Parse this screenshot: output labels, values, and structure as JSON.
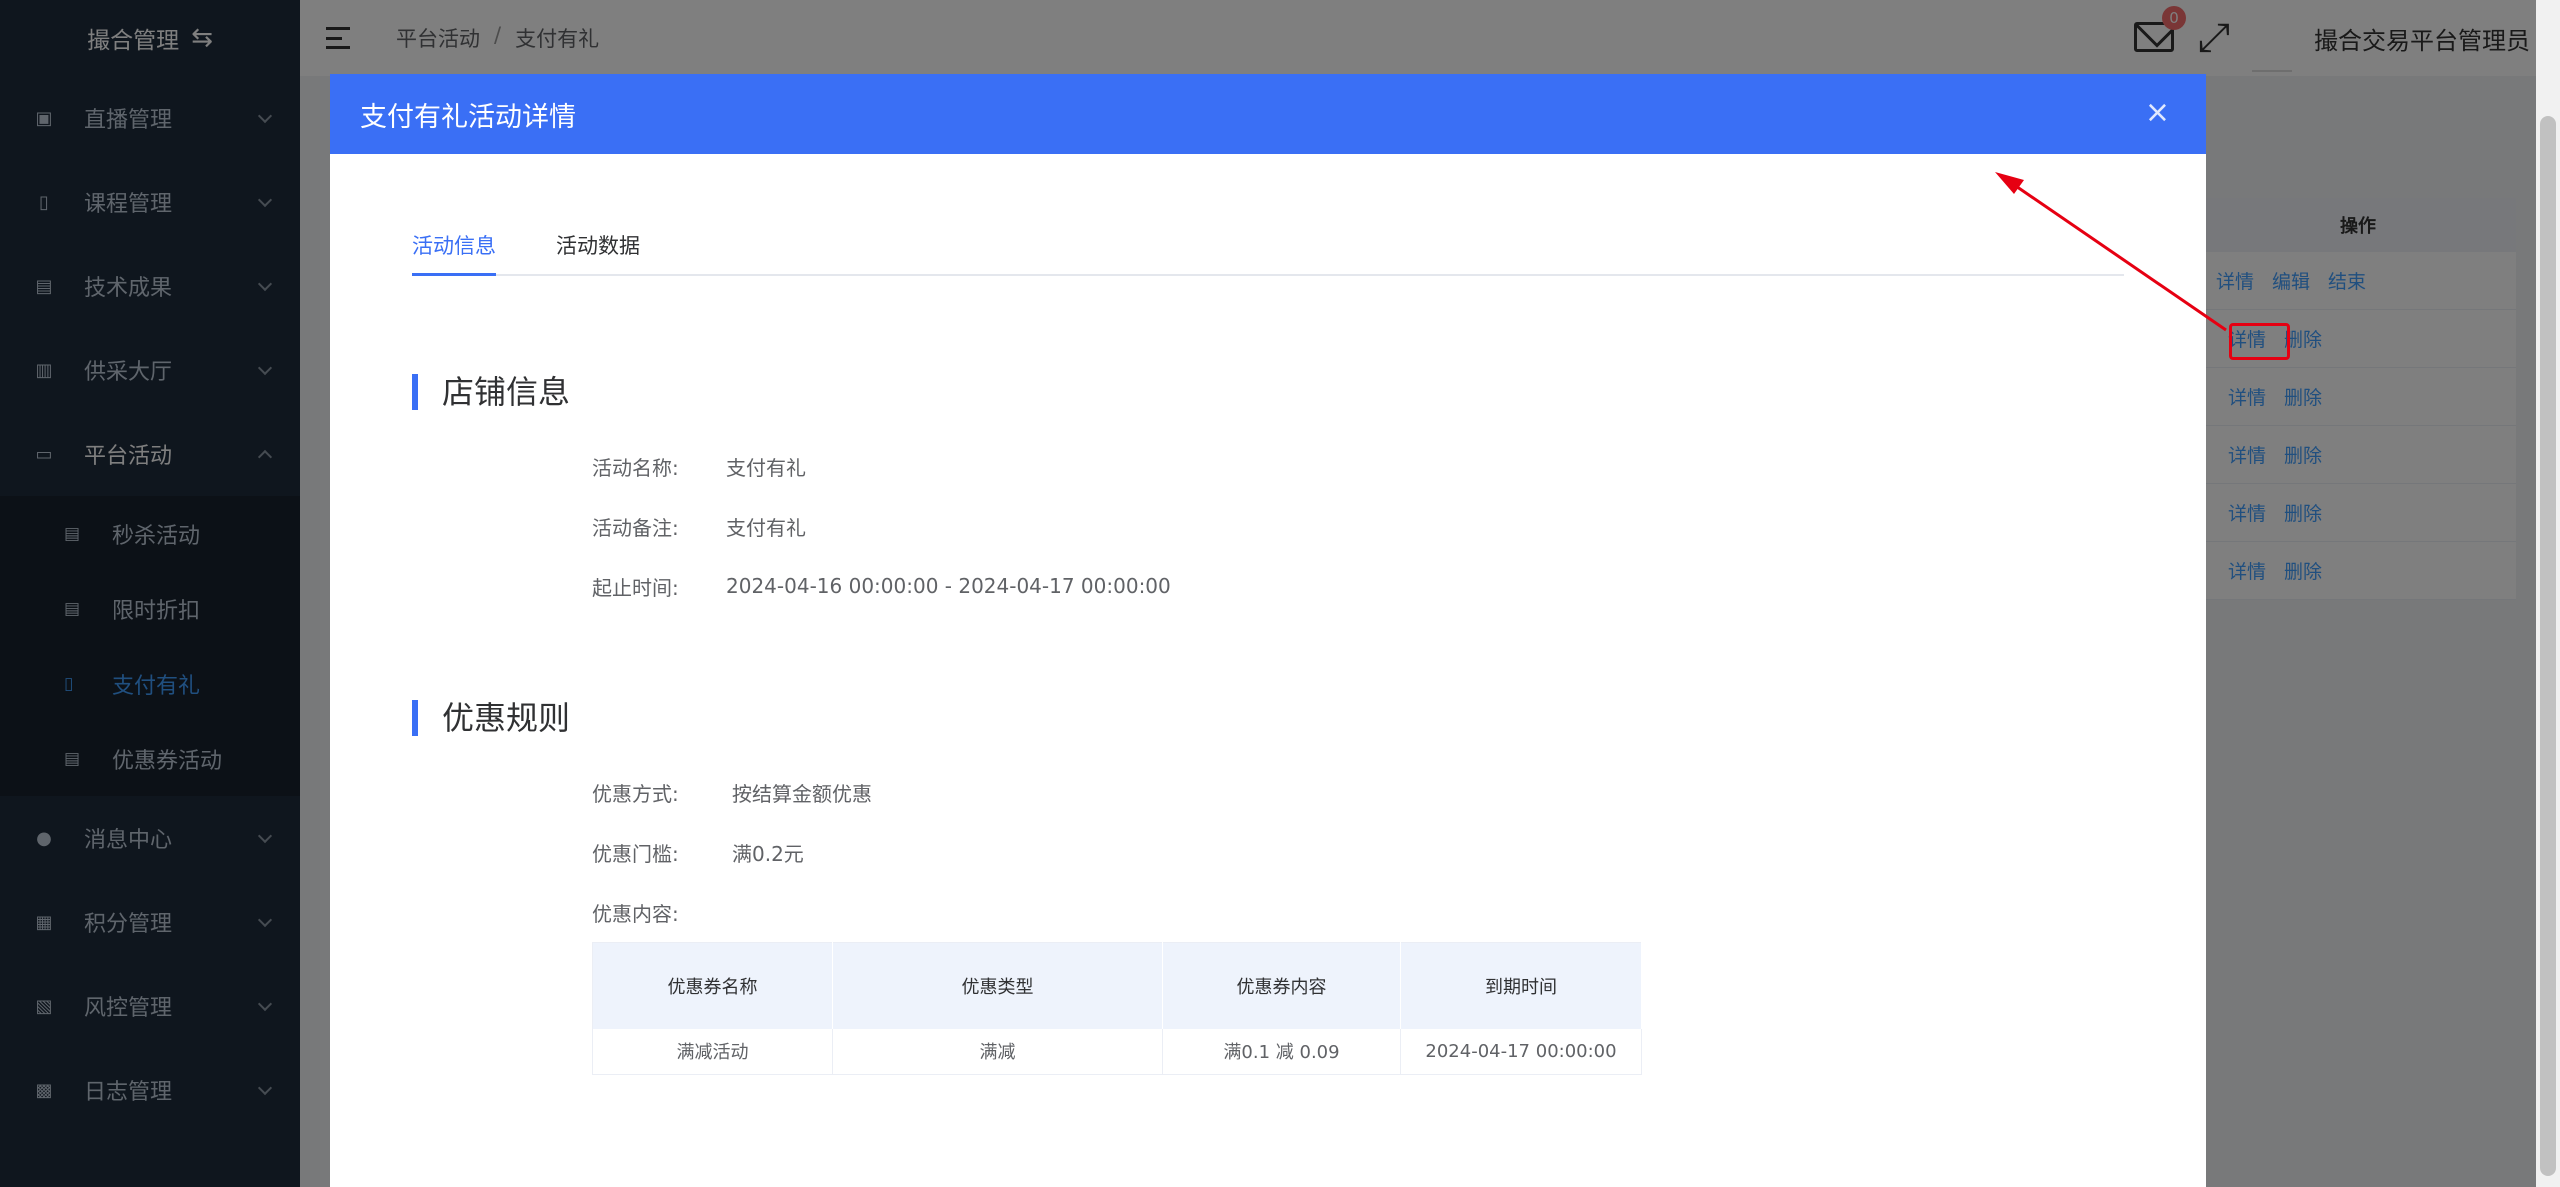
{
  "sidebar": {
    "brand": "撮合管理",
    "items": [
      {
        "label": "直播管理"
      },
      {
        "label": "课程管理"
      },
      {
        "label": "技术成果"
      },
      {
        "label": "供采大厅"
      },
      {
        "label": "平台活动"
      },
      {
        "label": "消息中心"
      },
      {
        "label": "积分管理"
      },
      {
        "label": "风控管理"
      },
      {
        "label": "日志管理"
      }
    ],
    "sub_items": [
      {
        "label": "秒杀活动"
      },
      {
        "label": "限时折扣"
      },
      {
        "label": "支付有礼"
      },
      {
        "label": "优惠券活动"
      }
    ]
  },
  "header": {
    "breadcrumb": [
      "平台活动",
      "支付有礼"
    ],
    "breadcrumb_sep": "/",
    "mail_badge": "0",
    "username": "撮合交易平台管理员"
  },
  "background_table": {
    "header": "操作",
    "row1": [
      "详情",
      "编辑",
      "结束"
    ],
    "rows": [
      [
        "详情",
        "删除"
      ],
      [
        "详情",
        "删除"
      ],
      [
        "详情",
        "删除"
      ],
      [
        "详情",
        "删除"
      ],
      [
        "详情",
        "删除"
      ]
    ]
  },
  "modal": {
    "title": "支付有礼活动详情",
    "close": "×",
    "tabs": [
      "活动信息",
      "活动数据"
    ],
    "shop_section": "店铺信息",
    "activity_name_label": "活动名称:",
    "activity_name": "支付有礼",
    "activity_note_label": "活动备注:",
    "activity_note": "支付有礼",
    "time_label": "起止时间:",
    "time_range": "2024-04-16 00:00:00 - 2024-04-17 00:00:00",
    "rules_section": "优惠规则",
    "method_label": "优惠方式:",
    "method": "按结算金额优惠",
    "threshold_label": "优惠门槛:",
    "threshold": "满0.2元",
    "content_label": "优惠内容:",
    "coupon_table": {
      "headers": [
        "优惠券名称",
        "优惠类型",
        "优惠券内容",
        "到期时间"
      ],
      "rows": [
        [
          "满减活动",
          "满减",
          "满0.1 减 0.09",
          "2024-04-17 00:00:00"
        ]
      ]
    }
  },
  "colors": {
    "sidebar_bg": "#1f2d3d",
    "modal_header": "#3a6ff5",
    "active": "#409eff",
    "annotation": "#e60012"
  }
}
